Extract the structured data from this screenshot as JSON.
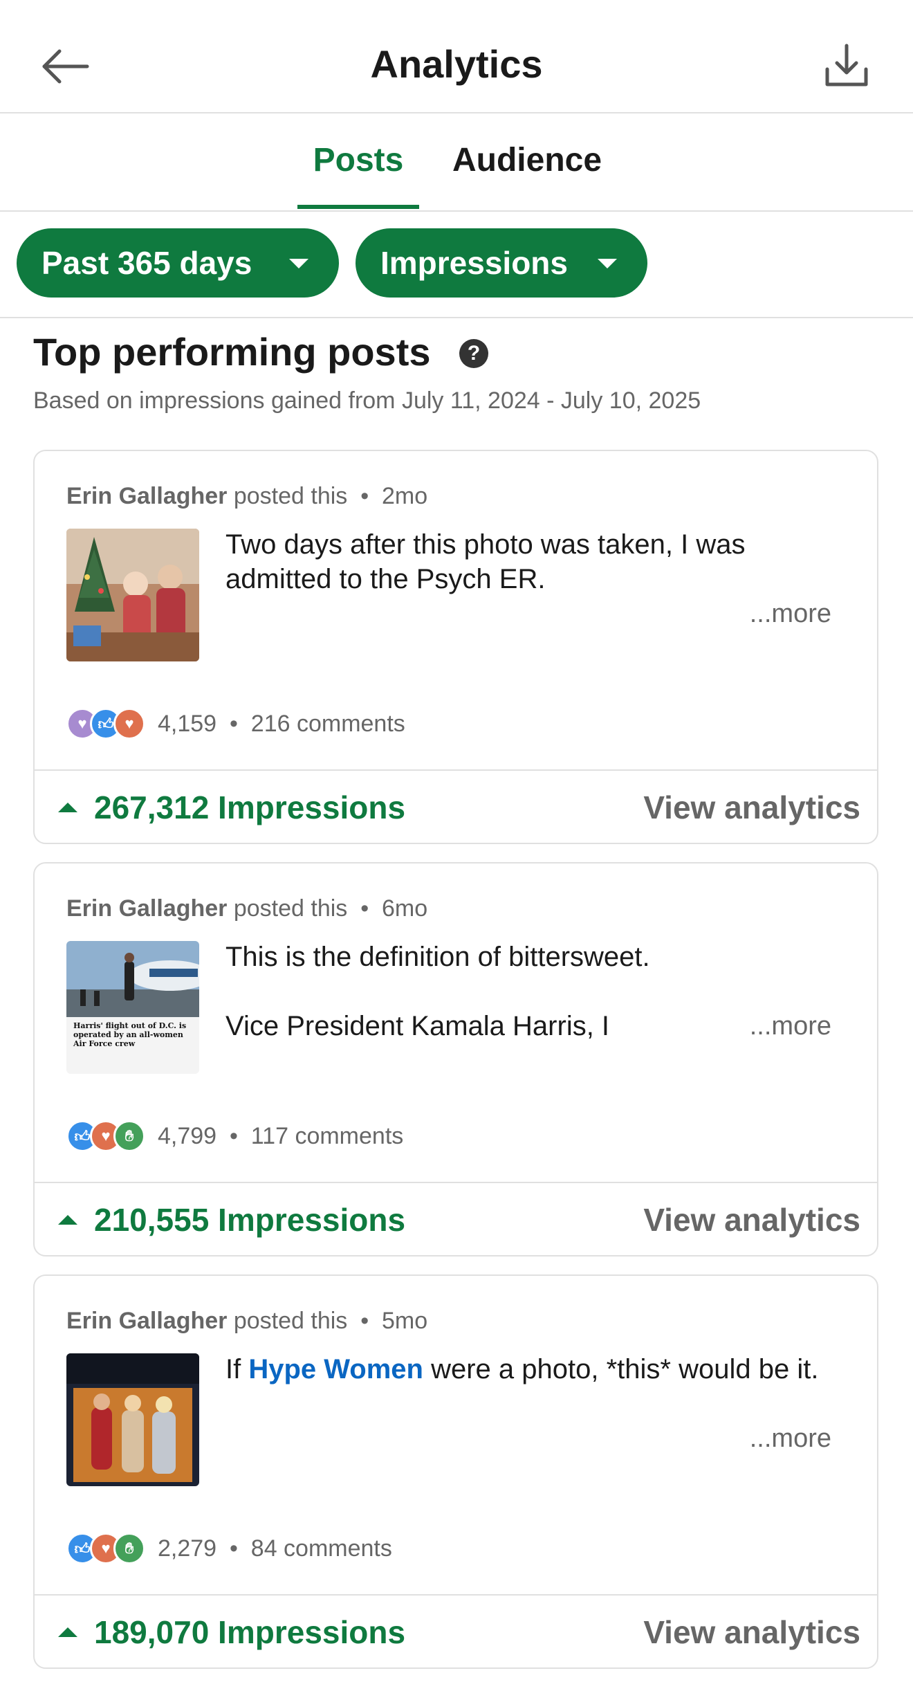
{
  "header": {
    "title": "Analytics"
  },
  "tabs": [
    {
      "label": "Posts",
      "active": true
    },
    {
      "label": "Audience",
      "active": false
    }
  ],
  "filters": {
    "range": "Past 365 days",
    "metric": "Impressions"
  },
  "section": {
    "title": "Top performing posts",
    "subtitle": "Based on impressions gained from July 11, 2024 - July 10, 2025"
  },
  "posts": [
    {
      "author": "Erin Gallagher",
      "action": "posted this",
      "age": "2mo",
      "text": "Two days after this photo was taken, I was admitted to the Psych ER.",
      "more": "...more",
      "reactions": [
        "support",
        "like",
        "love"
      ],
      "reaction_count": "4,159",
      "comments": "216 comments",
      "impressions": "267,312 Impressions",
      "view_analytics": "View analytics"
    },
    {
      "author": "Erin Gallagher",
      "action": "posted this",
      "age": "6mo",
      "text_line1": "This is the definition of bittersweet.",
      "text_line2": "Vice President Kamala Harris, I",
      "more": "...more",
      "thumb_caption": "Harris' flight out of D.C. is operated by an all-women Air Force crew",
      "reactions": [
        "like",
        "love",
        "celebrate"
      ],
      "reaction_count": "4,799",
      "comments": "117 comments",
      "impressions": "210,555 Impressions",
      "view_analytics": "View analytics"
    },
    {
      "author": "Erin Gallagher",
      "action": "posted this",
      "age": "5mo",
      "text_prefix": "If ",
      "text_link": "Hype Women",
      "text_suffix": " were a photo, *this* would be it.",
      "more": "...more",
      "reactions": [
        "like",
        "love",
        "celebrate"
      ],
      "reaction_count": "2,279",
      "comments": "84 comments",
      "impressions": "189,070 Impressions",
      "view_analytics": "View analytics"
    }
  ],
  "colors": {
    "accent": "#0f7a3f",
    "link": "#0a66c2",
    "muted": "#666666",
    "divider": "#e0e0e0"
  }
}
